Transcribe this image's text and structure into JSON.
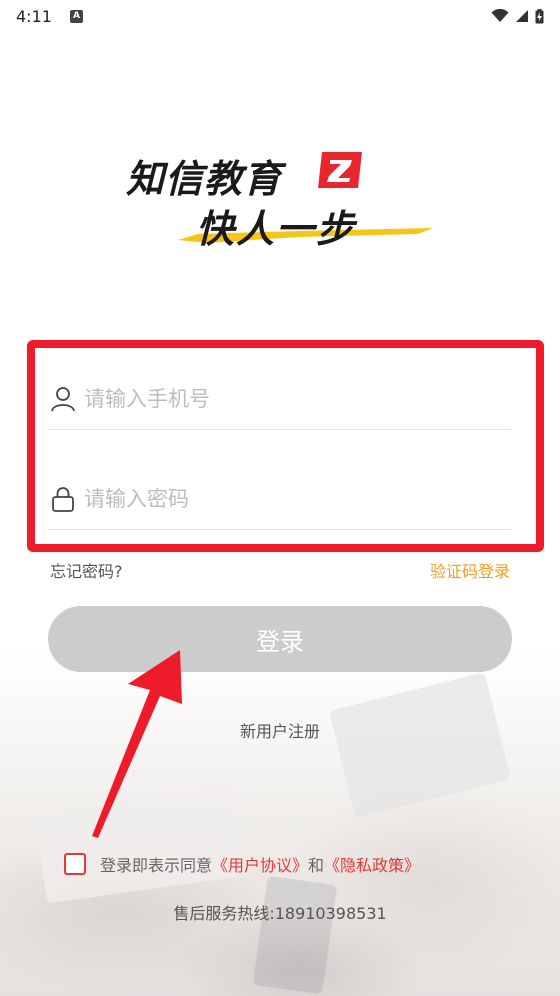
{
  "status_bar": {
    "time": "4:11",
    "notification_icon": "a-icon",
    "wifi_icon": "wifi-icon",
    "signal_icon": "signal-icon",
    "battery_icon": "battery-charging-icon"
  },
  "logo": {
    "line1": "知信教育",
    "line2": "快人一步",
    "brand_color": "#e8262e",
    "stroke_color": "#f5c518"
  },
  "form": {
    "phone_placeholder": "请输入手机号",
    "password_placeholder": "请输入密码",
    "phone_value": "",
    "password_value": "",
    "phone_icon": "user-icon",
    "password_icon": "lock-icon",
    "highlight_color": "#ee1c2a"
  },
  "links": {
    "forgot_password": "忘记密码?",
    "sms_login": "验证码登录"
  },
  "login_button": "登录",
  "register": "新用户注册",
  "agreement": {
    "prefix": "登录即表示同意",
    "user_agreement": "《用户协议》",
    "and": "和",
    "privacy_policy": "《隐私政策》",
    "checked": false
  },
  "hotline": "售后服务热线:18910398531",
  "colors": {
    "accent_orange": "#f0a020",
    "link_red": "#e53935",
    "button_disabled": "#cccccc"
  }
}
